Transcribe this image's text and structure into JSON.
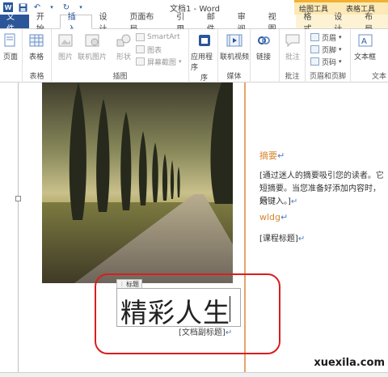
{
  "window": {
    "title": "文档1 - Word",
    "context_groups": [
      "绘图工具",
      "表格工具"
    ]
  },
  "tabs": [
    "文件",
    "开始",
    "插入",
    "设计",
    "页面布局",
    "引用",
    "邮件",
    "审阅",
    "视图",
    "格式",
    "设计",
    "布局"
  ],
  "ribbon": {
    "pages": {
      "label": "页面",
      "group": ""
    },
    "table": {
      "label": "表格",
      "group": "表格"
    },
    "illustrations": {
      "group": "插图",
      "picture": "图片",
      "online_picture": "联机图片",
      "shapes": "形状",
      "smartart": "SmartArt",
      "chart": "图表",
      "screenshot": "屏幕截图"
    },
    "apps": {
      "label": "应用程序",
      "sub": "序"
    },
    "media": {
      "online_video": "联机视频",
      "group": "媒体"
    },
    "links": {
      "label": "链接"
    },
    "comments": {
      "label": "批注",
      "group": "批注"
    },
    "header_footer": {
      "header": "页眉",
      "footer": "页脚",
      "page_number": "页码",
      "group": "页眉和页脚"
    },
    "text": {
      "textbox": "文本框",
      "group": "文本"
    }
  },
  "document": {
    "abstract_heading": "摘要",
    "abstract_line1": "[通过迷人的摘要吸引您的读者。它",
    "abstract_line2": "短摘要。当您准备好添加内容时，只",
    "abstract_line3": "始键入。]",
    "author": "wldg",
    "course_title": "[课程标题]",
    "title_tag": "标题",
    "title": "精彩人生",
    "subtitle": "[文档副标题]"
  },
  "watermark": "xuexila.com",
  "colors": {
    "brand": "#2b579a",
    "accent_orange": "#d6862e",
    "highlight_red": "#d81e1e",
    "context_tab": "#fce9b6"
  }
}
